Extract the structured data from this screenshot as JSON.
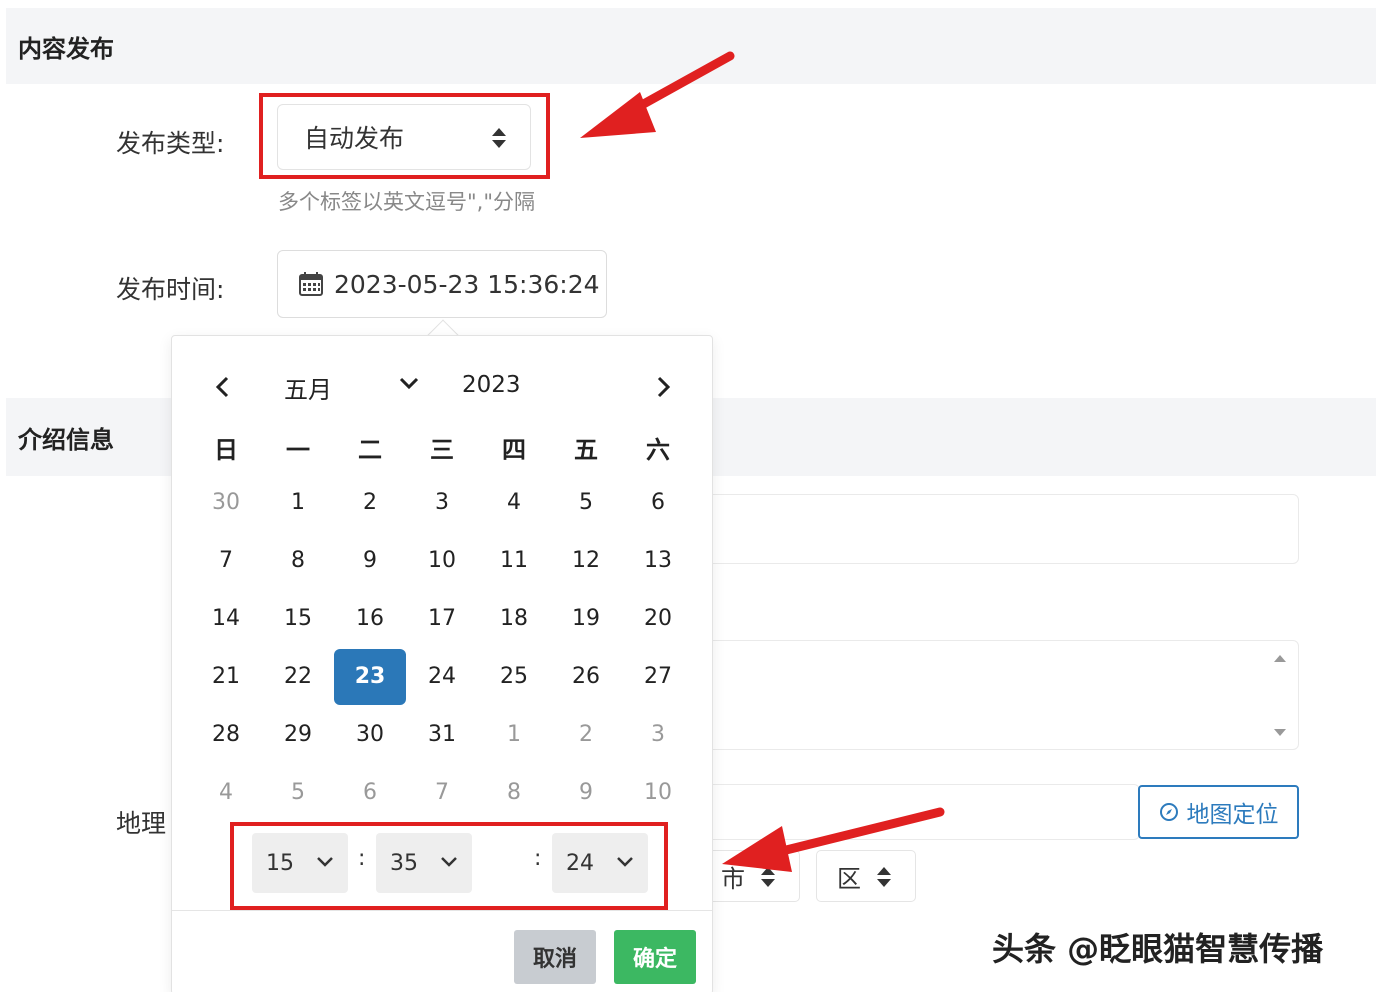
{
  "sections": {
    "content_publish": "内容发布",
    "intro_info": "介绍信息"
  },
  "form": {
    "publish_type_label": "发布类型:",
    "publish_type_value": "自动发布",
    "tags_hint": "多个标签以英文逗号\",\"分隔",
    "publish_time_label": "发布时间:",
    "publish_time_value": "2023-05-23 15:36:24",
    "geo_label": "地理",
    "city_select": "市",
    "district_select": "区",
    "map_button": "地图定位"
  },
  "datepicker": {
    "month": "五月",
    "year": "2023",
    "weekdays": [
      "日",
      "一",
      "二",
      "三",
      "四",
      "五",
      "六"
    ],
    "weeks": [
      [
        "30",
        "1",
        "2",
        "3",
        "4",
        "5",
        "6"
      ],
      [
        "7",
        "8",
        "9",
        "10",
        "11",
        "12",
        "13"
      ],
      [
        "14",
        "15",
        "16",
        "17",
        "18",
        "19",
        "20"
      ],
      [
        "21",
        "22",
        "23",
        "24",
        "25",
        "26",
        "27"
      ],
      [
        "28",
        "29",
        "30",
        "31",
        "1",
        "2",
        "3"
      ],
      [
        "4",
        "5",
        "6",
        "7",
        "8",
        "9",
        "10"
      ]
    ],
    "selected_day": "23",
    "time": {
      "hour": "15",
      "minute": "35",
      "second": "24"
    },
    "cancel_label": "取消",
    "confirm_label": "确定"
  },
  "watermark": "头条 @眨眼猫智慧传播",
  "colors": {
    "highlight_red": "#e02020",
    "selected_blue": "#2b78b8",
    "confirm_green": "#3cb862",
    "link_blue": "#2d7bbd"
  }
}
